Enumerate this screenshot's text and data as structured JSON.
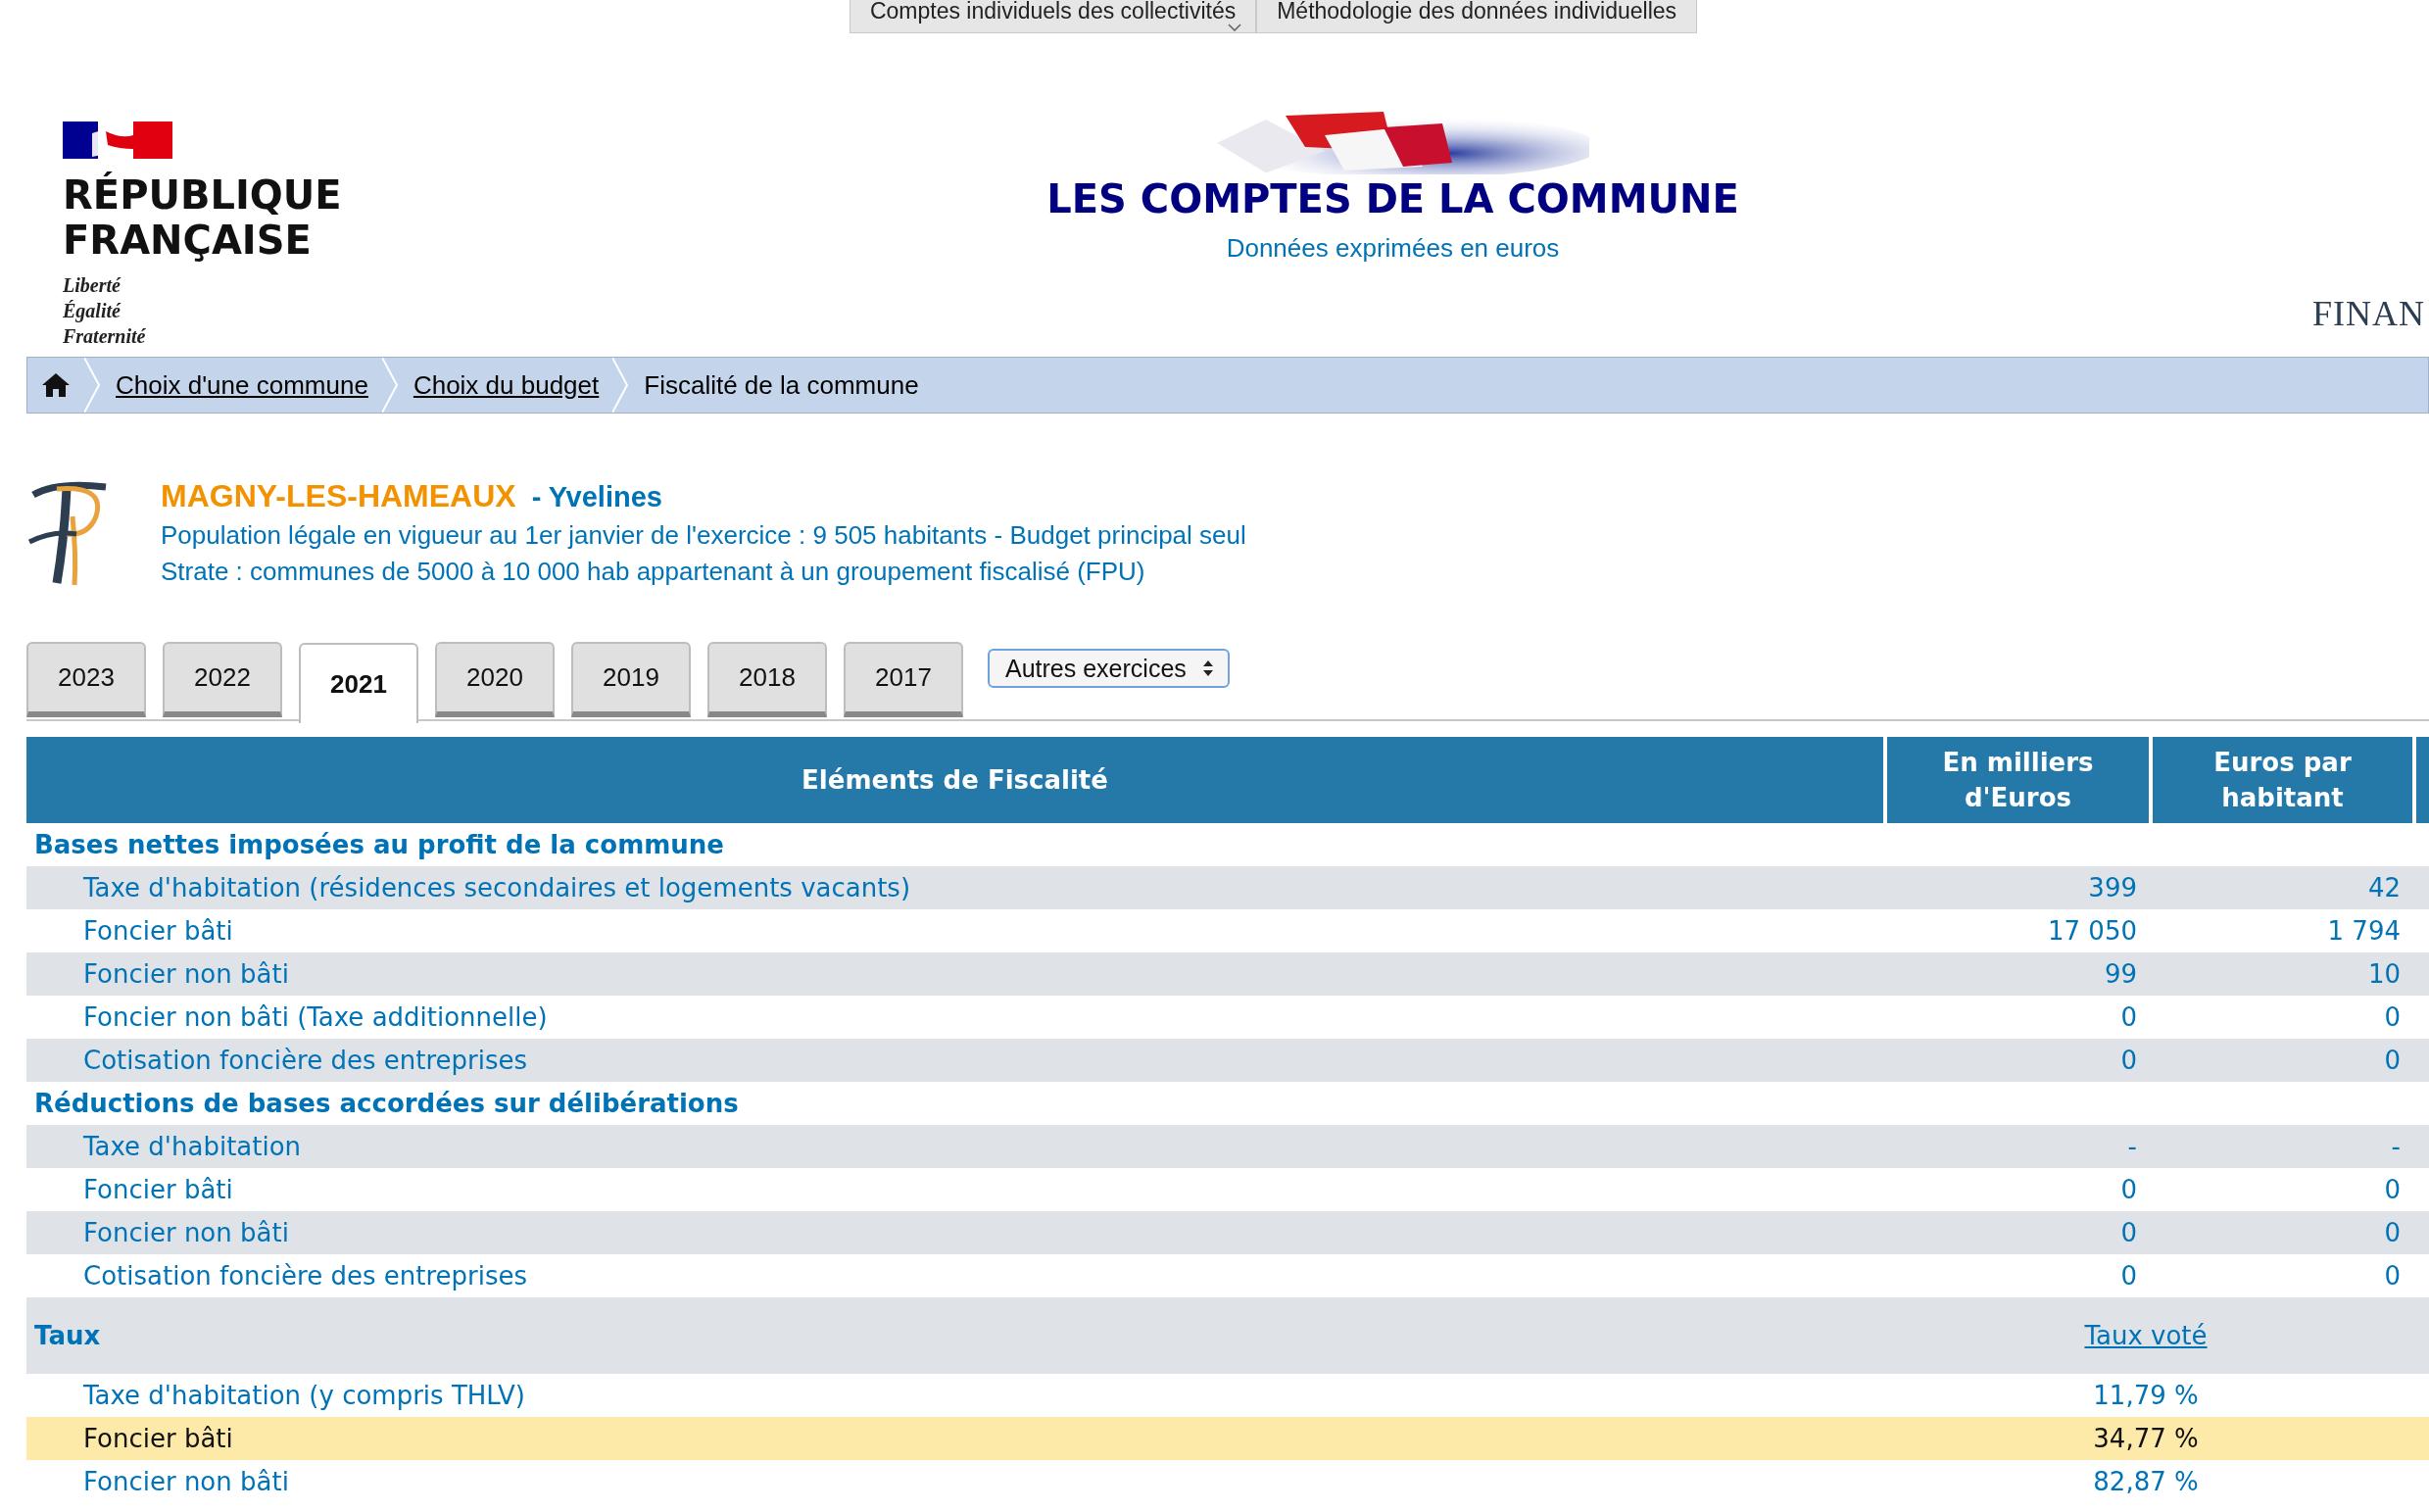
{
  "top_menu": [
    {
      "label": "Comptes individuels des collectivités",
      "has_dropdown": true
    },
    {
      "label": "Méthodologie des données individuelles",
      "has_dropdown": false
    }
  ],
  "header": {
    "republic": {
      "line1": "RÉPUBLIQUE",
      "line2": "FRANÇAISE",
      "motto": [
        "Liberté",
        "Égalité",
        "Fraternité"
      ]
    },
    "title": "LES COMPTES DE LA COMMUNE",
    "subtitle": "Données exprimées en euros",
    "right_text": "FINAN"
  },
  "breadcrumb": [
    {
      "label": "Choix d'une commune",
      "link": true
    },
    {
      "label": "Choix du budget",
      "link": true
    },
    {
      "label": "Fiscalité de la commune",
      "link": false
    }
  ],
  "commune": {
    "name": "MAGNY-LES-HAMEAUX",
    "department": "- Yvelines",
    "population": "Population légale en vigueur au 1er janvier de l'exercice : 9 505 habitants - Budget principal seul",
    "strate": "Strate : communes de 5000 à 10 000 hab appartenant à un groupement fiscalisé (FPU)"
  },
  "year_tabs": [
    {
      "label": "2023",
      "selected": false
    },
    {
      "label": "2022",
      "selected": false
    },
    {
      "label": "2021",
      "selected": true
    },
    {
      "label": "2020",
      "selected": false
    },
    {
      "label": "2019",
      "selected": false
    },
    {
      "label": "2018",
      "selected": false
    },
    {
      "label": "2017",
      "selected": false
    }
  ],
  "other_years": {
    "value": "Autres exercices"
  },
  "table": {
    "columns": [
      "Eléments de Fiscalité",
      "En milliers d'Euros",
      "Euros par habitant"
    ],
    "sections": [
      {
        "kind": "bases",
        "title": "Bases nettes imposées au profit de la commune",
        "rows": [
          {
            "label": "Taxe d'habitation (résidences secondaires et logements vacants)",
            "values": [
              "399",
              "42"
            ]
          },
          {
            "label": "Foncier bâti",
            "values": [
              "17 050",
              "1 794"
            ]
          },
          {
            "label": "Foncier non bâti",
            "values": [
              "99",
              "10"
            ]
          },
          {
            "label": "Foncier non bâti (Taxe additionnelle)",
            "values": [
              "0",
              "0"
            ]
          },
          {
            "label": "Cotisation foncière des entreprises",
            "values": [
              "0",
              "0"
            ]
          }
        ]
      },
      {
        "kind": "bases",
        "title": "Réductions de bases accordées sur délibérations",
        "rows": [
          {
            "label": "Taxe d'habitation",
            "values": [
              "-",
              "-"
            ]
          },
          {
            "label": "Foncier bâti",
            "values": [
              "0",
              "0"
            ]
          },
          {
            "label": "Foncier non bâti",
            "values": [
              "0",
              "0"
            ]
          },
          {
            "label": "Cotisation foncière des entreprises",
            "values": [
              "0",
              "0"
            ]
          }
        ]
      },
      {
        "kind": "rates",
        "title": "Taux",
        "link": "Taux voté",
        "rows": [
          {
            "label": "Taxe d'habitation (y compris THLV)",
            "value": "11,79 %",
            "highlighted": false
          },
          {
            "label": "Foncier bâti",
            "value": "34,77 %",
            "highlighted": true
          },
          {
            "label": "Foncier non bâti",
            "value": "82,87 %",
            "highlighted": false
          }
        ]
      }
    ]
  }
}
